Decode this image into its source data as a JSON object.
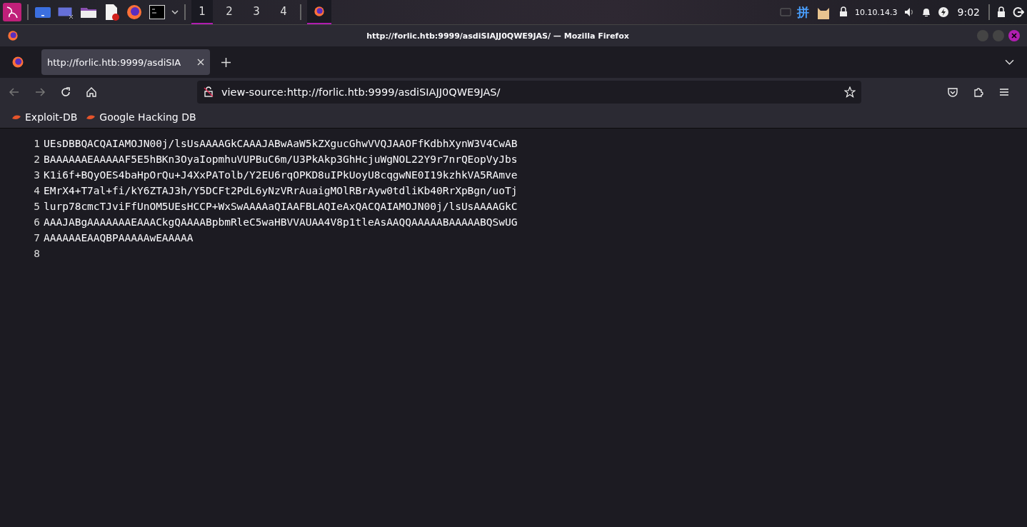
{
  "taskbar": {
    "workspaces": [
      {
        "label": "1",
        "selected": true
      },
      {
        "label": "2",
        "selected": false
      },
      {
        "label": "3",
        "selected": false
      },
      {
        "label": "4",
        "selected": false
      }
    ],
    "window_task_selected": true,
    "input_method": "拼",
    "ip": "10.10.14.3",
    "clock": "9:02"
  },
  "window": {
    "title": "http://forlic.htb:9999/asdiSIAJJ0QWE9JAS/ — Mozilla Firefox"
  },
  "tabs": [
    {
      "label": "http://forlic.htb:9999/asdiSIA",
      "selected": true
    }
  ],
  "address_bar": {
    "value": "view-source:http://forlic.htb:9999/asdiSIAJJ0QWE9JAS/"
  },
  "bookmarks": [
    "Exploit-DB",
    "Google Hacking DB"
  ],
  "source_lines": [
    {
      "number": "1",
      "text": "UEsDBBQACQAIAMOJN00j/lsUsAAAAGkCAAAJABwAaW5kZXgucGhwVVQJAAOFfKdbhXynW3V4CwAB"
    },
    {
      "number": "2",
      "text": "BAAAAAAEAAAAAF5E5hBKn3OyaIopmhuVUPBuC6m/U3PkAkp3GhHcjuWgNOL22Y9r7nrQEopVyJbs"
    },
    {
      "number": "3",
      "text": "K1i6f+BQyOES4baHpOrQu+J4XxPATolb/Y2EU6rqOPKD8uIPkUoyU8cqgwNE0I19kzhkVA5RAmve"
    },
    {
      "number": "4",
      "text": "EMrX4+T7al+fi/kY6ZTAJ3h/Y5DCFt2PdL6yNzVRrAuaigMOlRBrAyw0tdliKb40RrXpBgn/uoTj"
    },
    {
      "number": "5",
      "text": "lurp78cmcTJviFfUnOM5UEsHCCP+WxSwAAAAaQIAAFBLAQIeAxQACQAIAMOJN00j/lsUsAAAAGkC"
    },
    {
      "number": "6",
      "text": "AAAJABgAAAAAAAEAAACkgQAAAABpbmRleC5waHBVVAUAA4V8p1tleAsAAQQAAAAABAAAAABQSwUG"
    },
    {
      "number": "7",
      "text": "AAAAAAEAAQBPAAAAAwEAAAAA"
    },
    {
      "number": "8"
    }
  ]
}
